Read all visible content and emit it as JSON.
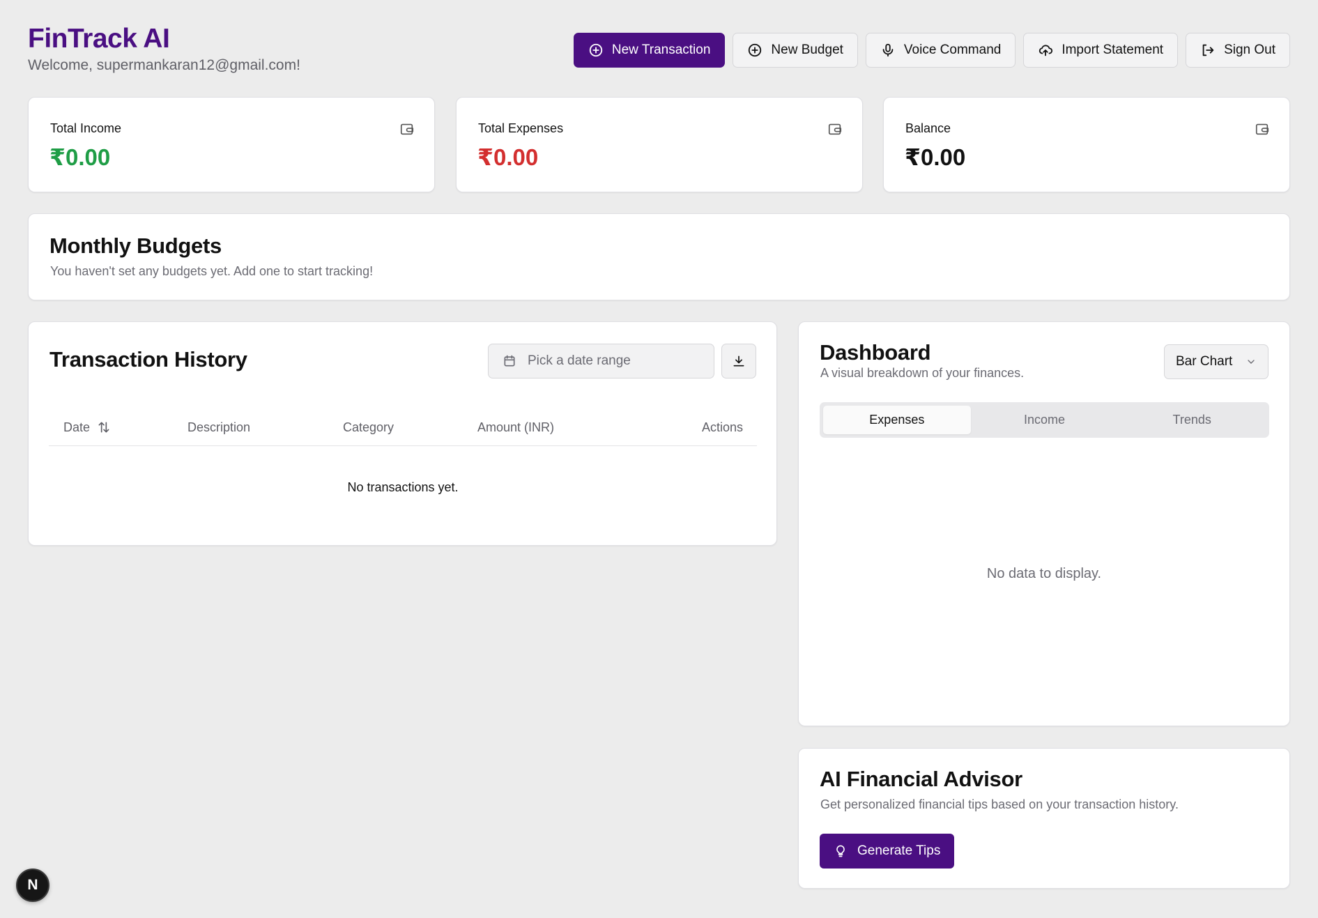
{
  "app": {
    "title": "FinTrack AI",
    "welcome": "Welcome, supermankaran12@gmail.com!",
    "brand_color": "#4a0f82"
  },
  "header_actions": [
    {
      "label": "New Transaction",
      "icon": "plus-circle-icon",
      "primary": true
    },
    {
      "label": "New Budget",
      "icon": "plus-circle-icon",
      "primary": false
    },
    {
      "label": "Voice Command",
      "icon": "mic-icon",
      "primary": false
    },
    {
      "label": "Import Statement",
      "icon": "cloud-upload-icon",
      "primary": false
    },
    {
      "label": "Sign Out",
      "icon": "log-out-icon",
      "primary": false
    }
  ],
  "stats": {
    "income": {
      "label": "Total Income",
      "value": "₹0.00",
      "color": "#1f9d46",
      "icon": "wallet-icon"
    },
    "expenses": {
      "label": "Total Expenses",
      "value": "₹0.00",
      "color": "#d32f2f",
      "icon": "wallet-icon"
    },
    "balance": {
      "label": "Balance",
      "value": "₹0.00",
      "color": "#111111",
      "icon": "wallet-icon"
    }
  },
  "budgets": {
    "title": "Monthly Budgets",
    "empty_text": "You haven't set any budgets yet. Add one to start tracking!"
  },
  "history": {
    "title": "Transaction History",
    "date_range_placeholder": "Pick a date range",
    "columns": [
      "Date",
      "Description",
      "Category",
      "Amount (INR)",
      "Actions"
    ],
    "empty_text": "No transactions yet."
  },
  "dashboard": {
    "title": "Dashboard",
    "subtitle": "A visual breakdown of your finances.",
    "chart_type": "Bar Chart",
    "tabs": [
      "Expenses",
      "Income",
      "Trends"
    ],
    "active_tab": "Expenses",
    "empty_text": "No data to display."
  },
  "advisor": {
    "title": "AI Financial Advisor",
    "subtitle": "Get personalized financial tips based on your transaction history.",
    "button_label": "Generate Tips"
  },
  "dev_badge": "N"
}
